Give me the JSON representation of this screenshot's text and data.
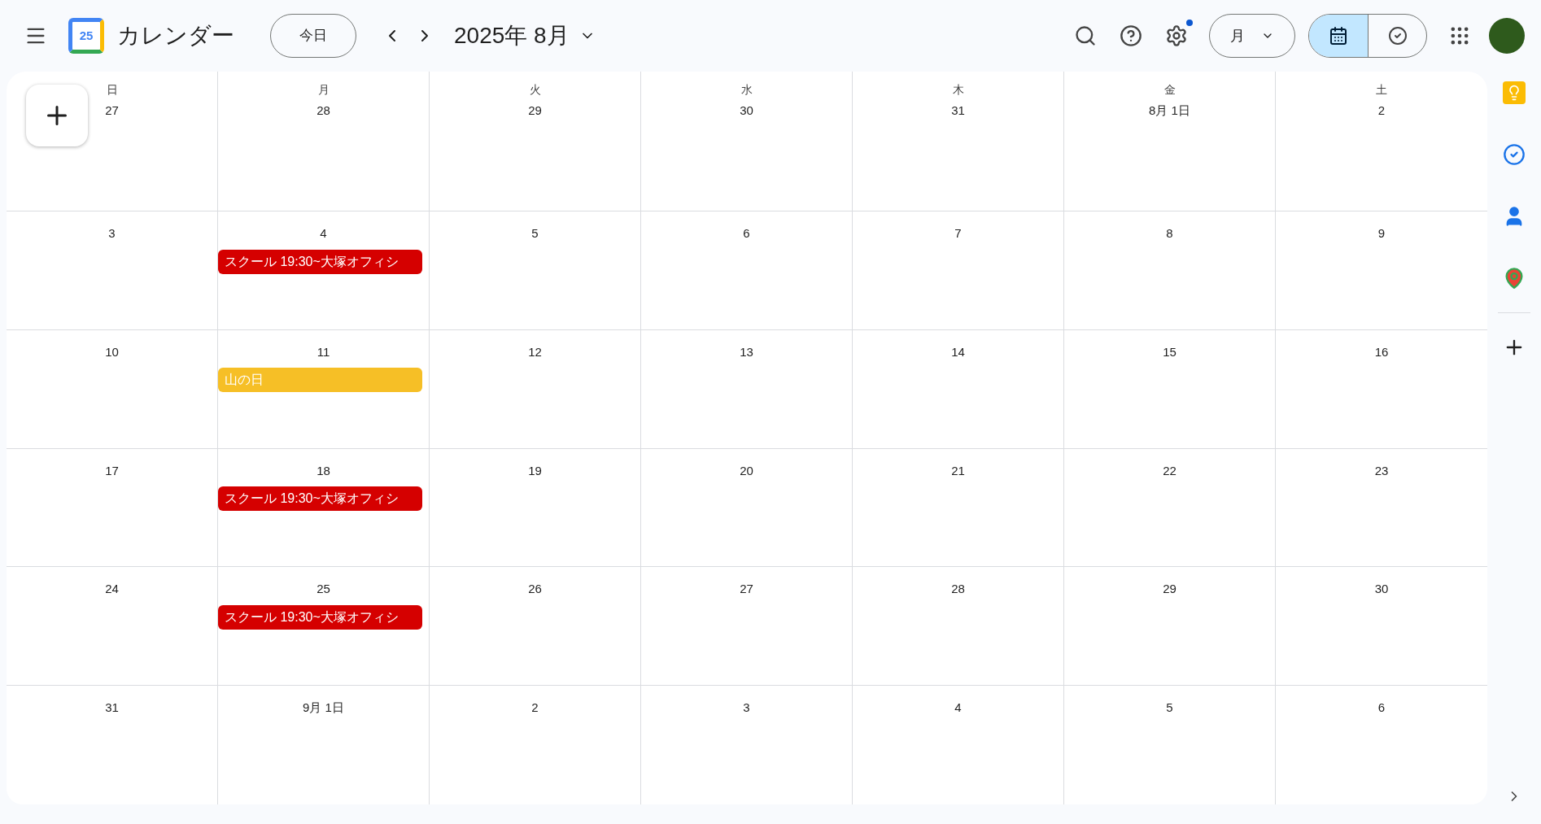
{
  "header": {
    "app_name": "カレンダー",
    "logo_text": "25",
    "today_button": "今日",
    "period": "2025年 8月",
    "settings_badge": true,
    "view_select": "月",
    "view_toggle": [
      {
        "kind": "calendar",
        "selected": true
      },
      {
        "kind": "tasks",
        "selected": false
      }
    ]
  },
  "weekdays": [
    "日",
    "月",
    "火",
    "水",
    "木",
    "金",
    "土"
  ],
  "weeks": [
    [
      {
        "label": "27"
      },
      {
        "label": "28"
      },
      {
        "label": "29"
      },
      {
        "label": "30"
      },
      {
        "label": "31"
      },
      {
        "label": "8月 1日"
      },
      {
        "label": "2"
      }
    ],
    [
      {
        "label": "3"
      },
      {
        "label": "4",
        "events": [
          {
            "title": "スクール 19:30~大塚オフィシ",
            "color": "#d50000"
          }
        ]
      },
      {
        "label": "5"
      },
      {
        "label": "6"
      },
      {
        "label": "7"
      },
      {
        "label": "8"
      },
      {
        "label": "9"
      }
    ],
    [
      {
        "label": "10"
      },
      {
        "label": "11",
        "events": [
          {
            "title": "山の日",
            "color": "#f6bf26"
          }
        ]
      },
      {
        "label": "12"
      },
      {
        "label": "13"
      },
      {
        "label": "14"
      },
      {
        "label": "15"
      },
      {
        "label": "16"
      }
    ],
    [
      {
        "label": "17"
      },
      {
        "label": "18",
        "events": [
          {
            "title": "スクール 19:30~大塚オフィシ",
            "color": "#d50000"
          }
        ]
      },
      {
        "label": "19"
      },
      {
        "label": "20"
      },
      {
        "label": "21"
      },
      {
        "label": "22"
      },
      {
        "label": "23"
      }
    ],
    [
      {
        "label": "24"
      },
      {
        "label": "25",
        "events": [
          {
            "title": "スクール 19:30~大塚オフィシ",
            "color": "#d50000"
          }
        ]
      },
      {
        "label": "26"
      },
      {
        "label": "27"
      },
      {
        "label": "28"
      },
      {
        "label": "29"
      },
      {
        "label": "30"
      }
    ],
    [
      {
        "label": "31"
      },
      {
        "label": "9月 1日"
      },
      {
        "label": "2"
      },
      {
        "label": "3"
      },
      {
        "label": "4"
      },
      {
        "label": "5"
      },
      {
        "label": "6"
      }
    ]
  ]
}
